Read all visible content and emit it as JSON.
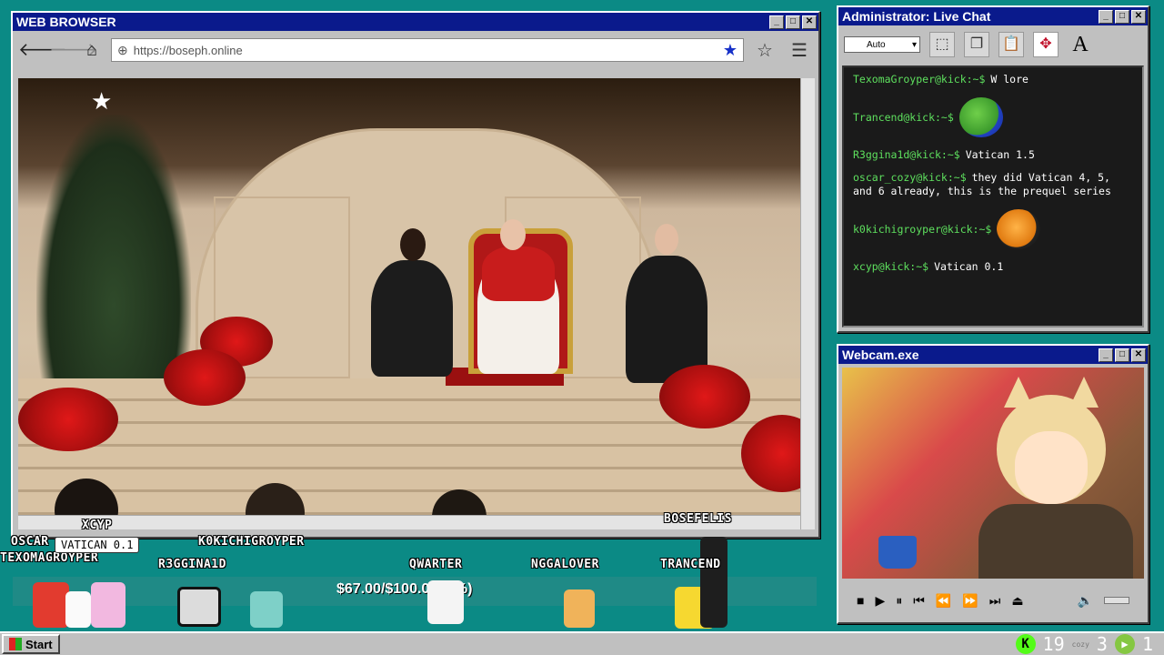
{
  "browser": {
    "title": "WEB BROWSER",
    "url": "https://boseph.online",
    "controls": {
      "min": "_",
      "max": "□",
      "close": "✕"
    }
  },
  "chat": {
    "title": "Administrator: Live Chat",
    "dropdown_value": "Auto",
    "tool_font": "A",
    "messages": [
      {
        "user": "TexomaGroyper@kick:~$",
        "text": "W lore",
        "emote": null
      },
      {
        "user": "Trancend@kick:~$",
        "text": "",
        "emote": "green-frog-emote"
      },
      {
        "user": "R3ggina1d@kick:~$",
        "text": "Vatican 1.5",
        "emote": null
      },
      {
        "user": "oscar_cozy@kick:~$",
        "text": "they did Vatican 4, 5, and 6 already, this is the prequel series",
        "emote": null
      },
      {
        "user": "k0kichigroyper@kick:~$",
        "text": "",
        "emote": "orange-frog-emote"
      },
      {
        "user": "xcyp@kick:~$",
        "text": "Vatican 0.1",
        "emote": null
      }
    ]
  },
  "webcam": {
    "title": "Webcam.exe"
  },
  "overlay": {
    "goal_text": "$67.00/$100.00 (7%)",
    "goal_fraction": 0.07,
    "bubble_text": "VATICAN 0.1",
    "usernames": [
      {
        "name": "XCYP",
        "id": "xcyp"
      },
      {
        "name": "OSCAR",
        "id": "oscar"
      },
      {
        "name": "TEXOMAGROYPER",
        "id": "texomagroyper"
      },
      {
        "name": "K0KICHIGROYPER",
        "id": "k0kichigroyper"
      },
      {
        "name": "R3GGINA1D",
        "id": "r3ggina1d"
      },
      {
        "name": "QWARTER",
        "id": "qwarter"
      },
      {
        "name": "NGGALOVER",
        "id": "nggalover"
      },
      {
        "name": "BOSEFELIS",
        "id": "bosefelis"
      },
      {
        "name": "TRANCEND",
        "id": "trancend"
      }
    ]
  },
  "taskbar": {
    "start_label": "Start",
    "kick_count": "19",
    "cozy_label": "cozy",
    "cozy_count": "3",
    "rumble_count": "1"
  }
}
